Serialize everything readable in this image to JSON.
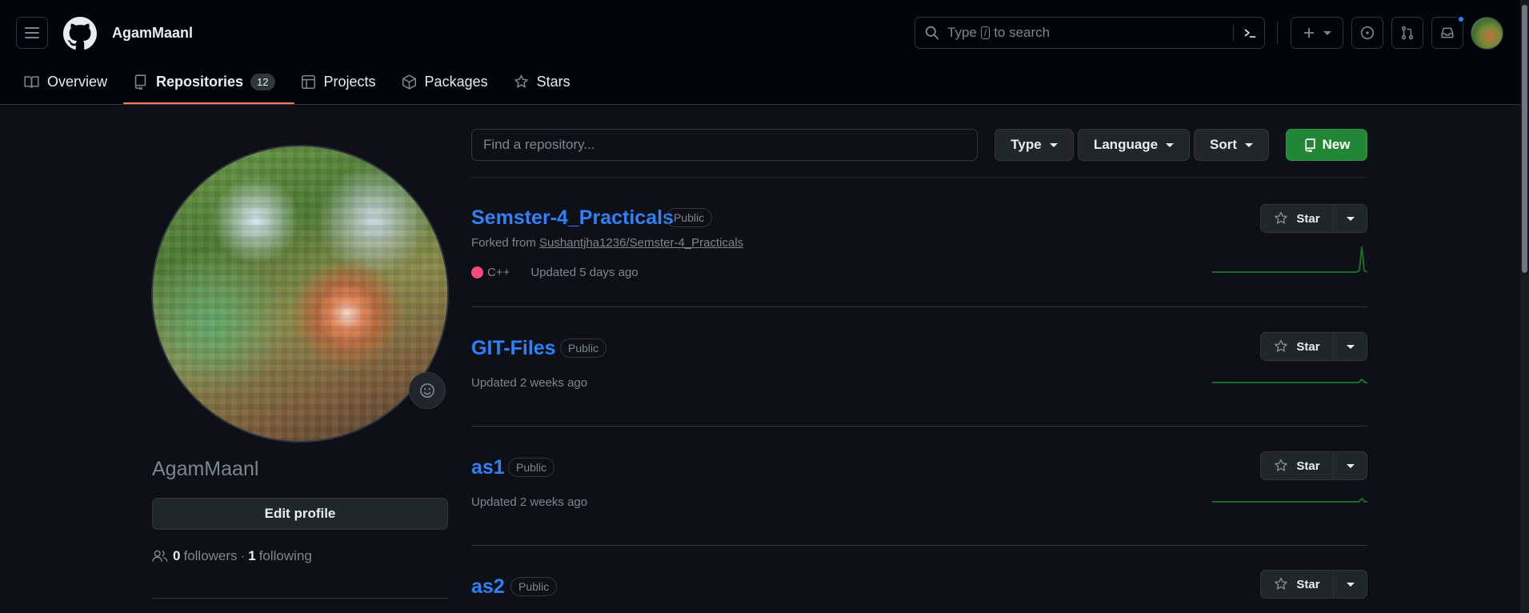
{
  "header": {
    "username": "AgamMaanl",
    "search": {
      "before": "Type",
      "key": "/",
      "after": "to search"
    }
  },
  "tabs": [
    {
      "label": "Overview",
      "icon": "book-icon"
    },
    {
      "label": "Repositories",
      "icon": "repo-icon",
      "count": "12",
      "active": true
    },
    {
      "label": "Projects",
      "icon": "table-icon"
    },
    {
      "label": "Packages",
      "icon": "package-icon"
    },
    {
      "label": "Stars",
      "icon": "star-icon"
    }
  ],
  "profile": {
    "name": "AgamMaanl",
    "edit_label": "Edit profile",
    "followers_count": "0",
    "followers_label": "followers",
    "separator": "·",
    "following_count": "1",
    "following_label": "following"
  },
  "filters": {
    "search_placeholder": "Find a repository...",
    "type_label": "Type",
    "language_label": "Language",
    "sort_label": "Sort",
    "new_label": "New"
  },
  "repos": [
    {
      "name": "Semster-4_Practicals",
      "visibility": "Public",
      "forked_prefix": "Forked from",
      "forked_from": "Sushantjha1236/Semster-4_Practicals",
      "language": "C++",
      "language_color": "#f34b7d",
      "updated": "Updated 5 days ago",
      "star_label": "Star"
    },
    {
      "name": "GIT-Files",
      "visibility": "Public",
      "updated": "Updated 2 weeks ago",
      "star_label": "Star"
    },
    {
      "name": "as1",
      "visibility": "Public",
      "updated": "Updated 2 weeks ago",
      "star_label": "Star"
    },
    {
      "name": "as2",
      "visibility": "Public",
      "star_label": "Star"
    }
  ],
  "colors": {
    "background": "#0d1117",
    "header": "#010409",
    "link": "#2f81f7",
    "new_button": "#238636",
    "tab_underline": "#f78166",
    "sparkline": "#196c2e"
  }
}
